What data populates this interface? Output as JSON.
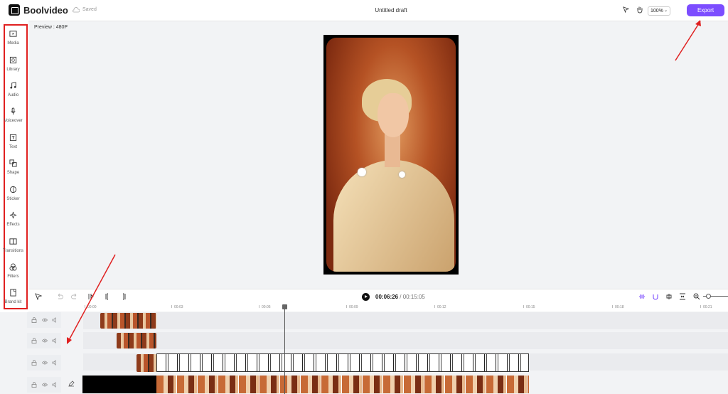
{
  "app": {
    "name": "Boolvideo",
    "saved_label": "Saved",
    "draft_title": "Untitled draft",
    "zoom": "100%",
    "export_label": "Export",
    "accent": "#7c4dff"
  },
  "preview": {
    "label": "Preview : 480P"
  },
  "sidebar": {
    "items": [
      {
        "label": "Media",
        "icon": "media-icon"
      },
      {
        "label": "Library",
        "icon": "library-icon"
      },
      {
        "label": "Audio",
        "icon": "audio-icon"
      },
      {
        "label": "Voiceover",
        "icon": "voiceover-icon"
      },
      {
        "label": "Text",
        "icon": "text-icon"
      },
      {
        "label": "Shape",
        "icon": "shape-icon"
      },
      {
        "label": "Sticker",
        "icon": "sticker-icon"
      },
      {
        "label": "Effects",
        "icon": "effects-icon"
      },
      {
        "label": "Transitions",
        "icon": "transitions-icon"
      },
      {
        "label": "Filters",
        "icon": "filters-icon"
      },
      {
        "label": "Brand kit",
        "icon": "brand-kit-icon"
      }
    ]
  },
  "timeline": {
    "current_time": "00:06:26",
    "separator": " / ",
    "total_time": "00:15:05",
    "ruler": [
      "00:00",
      "00:03",
      "00:06",
      "00:09",
      "00:12",
      "00:15",
      "00:18",
      "00:21"
    ]
  }
}
